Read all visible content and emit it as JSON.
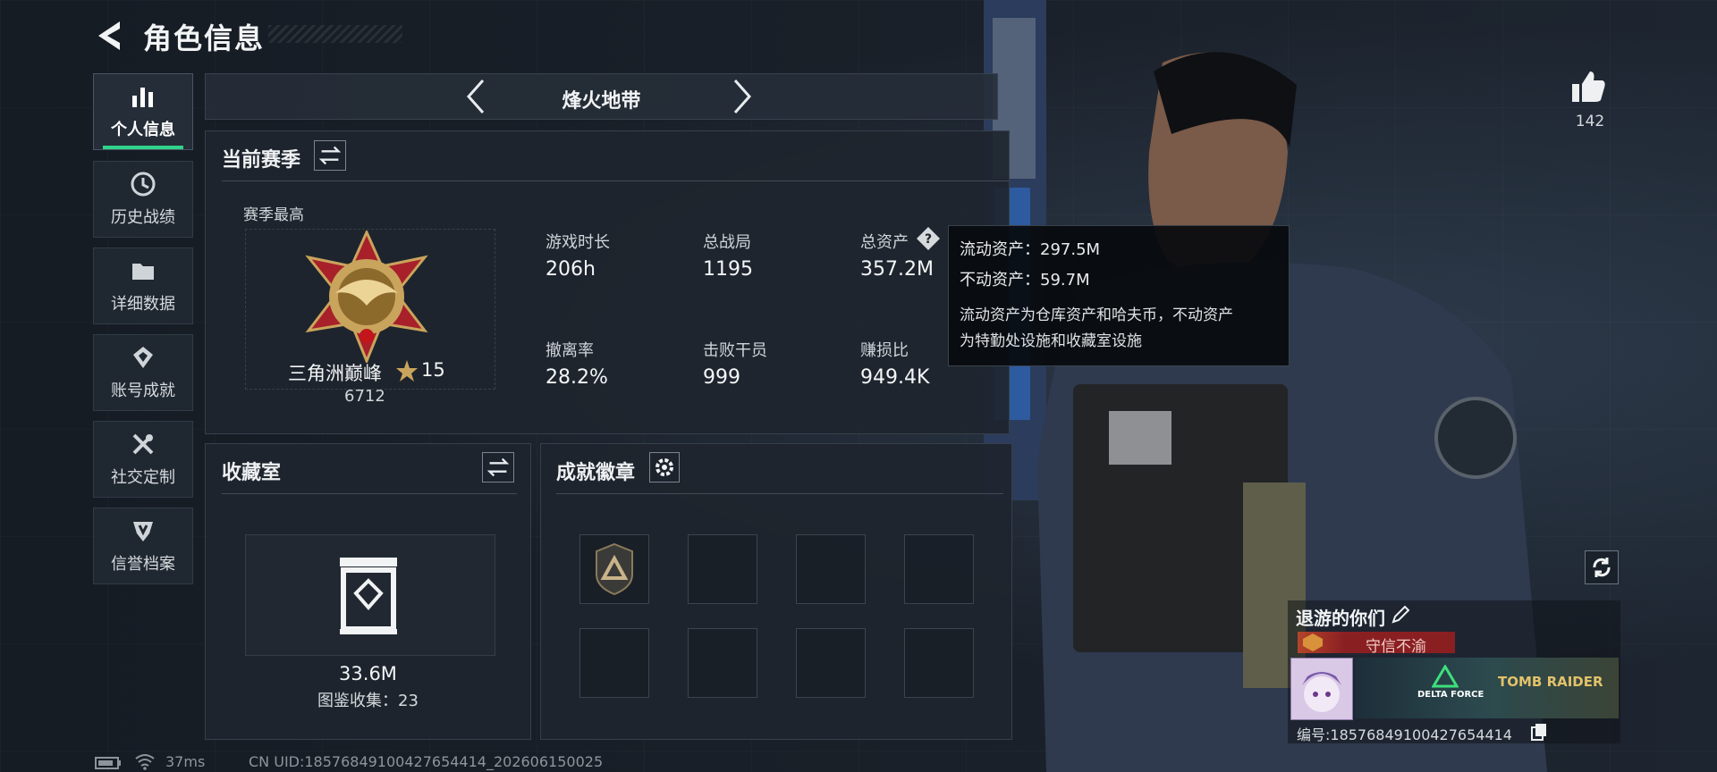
{
  "header": {
    "title": "角色信息"
  },
  "sidebar": {
    "items": [
      {
        "label": "个人信息",
        "icon": "bar-chart-icon",
        "active": true
      },
      {
        "label": "历史战绩",
        "icon": "history-clock-icon"
      },
      {
        "label": "详细数据",
        "icon": "folder-icon"
      },
      {
        "label": "账号成就",
        "icon": "achievement-badge-icon"
      },
      {
        "label": "社交定制",
        "icon": "tools-icon"
      },
      {
        "label": "信誉档案",
        "icon": "shield-icon"
      }
    ]
  },
  "mode": {
    "label": "烽火地带"
  },
  "season": {
    "title": "当前赛季",
    "best_label": "赛季最高",
    "rank_name": "三角洲巅峰",
    "rank_stars": "15",
    "rank_score": "6712",
    "stats": [
      {
        "label": "游戏时长",
        "value": "206h"
      },
      {
        "label": "总战局",
        "value": "1195"
      },
      {
        "label": "总资产",
        "value": "357.2M"
      },
      {
        "label": "撤离率",
        "value": "28.2%"
      },
      {
        "label": "击败干员",
        "value": "999"
      },
      {
        "label": "赚损比",
        "value": "949.4K"
      }
    ]
  },
  "tooltip": {
    "liquid": "流动资产：297.5M",
    "fixed": "不动资产：59.7M",
    "desc_1": "流动资产为仓库资产和哈夫币，不动资产",
    "desc_2": "为特勤处设施和收藏室设施"
  },
  "collection": {
    "title": "收藏室",
    "value": "33.6M",
    "count": "图鉴收集：23"
  },
  "badges": {
    "title": "成就徽章",
    "slot_count": 8
  },
  "likes": {
    "count": "142"
  },
  "profile": {
    "name": "退游的你们",
    "honor": "守信不渝",
    "id": "编号:18576849100427654414",
    "banner_text_1": "DELTA FORCE",
    "banner_text_2": "TOMB RAIDER"
  },
  "footer": {
    "ping": "37ms",
    "uid": "CN UID:18576849100427654414_202606150025"
  },
  "colors": {
    "accent": "#2fd38a",
    "honor_bar": "#8a1f22",
    "gold": "#c9a45c"
  }
}
